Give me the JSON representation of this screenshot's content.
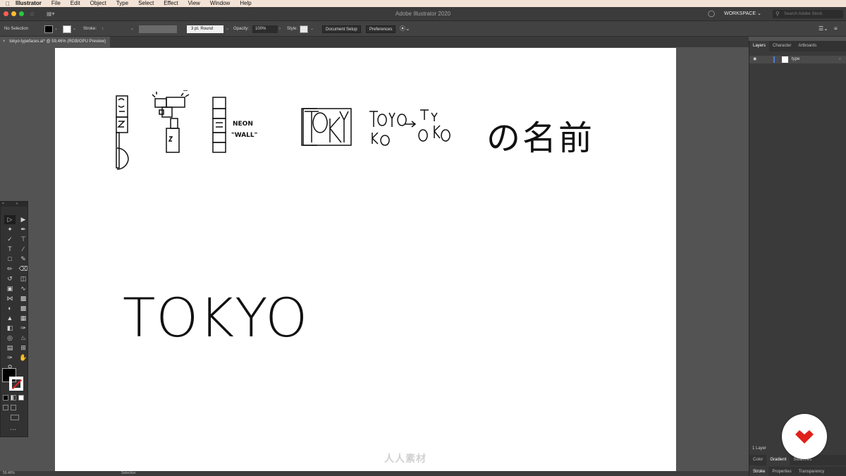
{
  "menubar": {
    "app": "Illustrator",
    "items": [
      "File",
      "Edit",
      "Object",
      "Type",
      "Select",
      "Effect",
      "View",
      "Window",
      "Help"
    ]
  },
  "titlebar": {
    "title": "Adobe Illustrator 2020",
    "workspace": "WORKSPACE",
    "search_placeholder": "Search Adobe Stock"
  },
  "controlbar": {
    "selection": "No Selection",
    "stroke_label": "Stroke:",
    "brush": "3 pt. Round",
    "opacity_label": "Opacity:",
    "opacity": "100%",
    "style_label": "Style:",
    "document_setup": "Document Setup",
    "preferences": "Preferences"
  },
  "document": {
    "tab_title": "tokyo-typefaces.ai* @ 59,46% (RGB/GPU Preview)"
  },
  "artboard": {
    "sketch_neon": "NEON",
    "sketch_wall": "\"WALL\"",
    "japanese_text": "の名前",
    "main_text": "TOKYO"
  },
  "panel": {
    "tabs": [
      "Layers",
      "Character",
      "Artboards"
    ],
    "layer_name": "type",
    "layer_count": "1 Layer",
    "bottom_tabs_1": [
      "Color",
      "Gradient",
      "Swatches"
    ],
    "bottom_tabs_2": [
      "Stroke",
      "Properties",
      "Transparency"
    ]
  },
  "statusbar": {
    "zoom": "59.46%",
    "tool": "Selection"
  },
  "watermark": {
    "text": "人人素材"
  },
  "colors": {
    "close": "#ff5f57",
    "minimize": "#febc2e",
    "zoom": "#28c840",
    "layer_color": "#4e7de0",
    "badge_red": "#e0201b"
  }
}
